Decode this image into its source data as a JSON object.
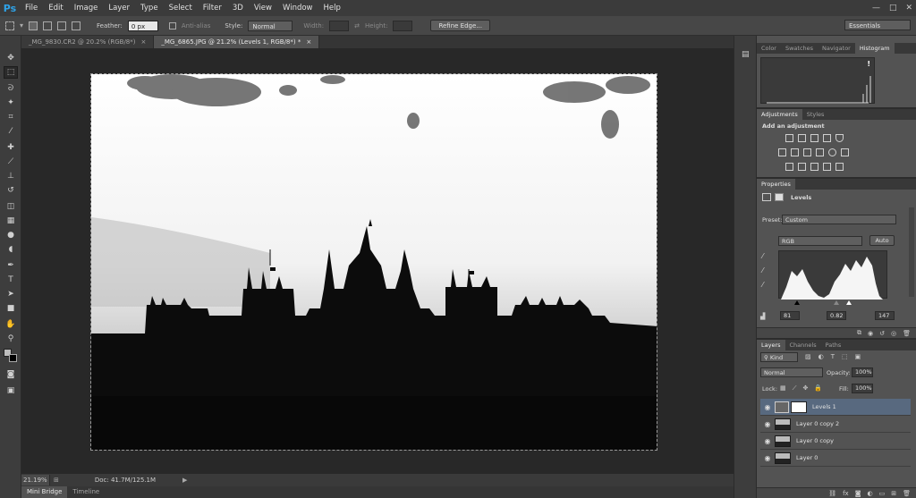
{
  "app": {
    "logo": "Ps"
  },
  "menu": [
    "File",
    "Edit",
    "Image",
    "Layer",
    "Type",
    "Select",
    "Filter",
    "3D",
    "View",
    "Window",
    "Help"
  ],
  "window_controls": [
    "—",
    "□",
    "✕"
  ],
  "options": {
    "feather_label": "Feather:",
    "feather_value": "0 px",
    "antialias_label": "Anti-alias",
    "style_label": "Style:",
    "style_value": "Normal",
    "width_label": "Width:",
    "height_label": "Height:",
    "refine_edge": "Refine Edge...",
    "workspace": "Essentials"
  },
  "doc_tabs": [
    {
      "title": "_MG_9830.CR2 @ 20.2% (RGB/8*)",
      "close": "×"
    },
    {
      "title": "_MG_6865.JPG @ 21.2% (Levels 1, RGB/8*) *",
      "close": "×"
    }
  ],
  "status": {
    "zoom": "21.19%",
    "doc": "Doc: 41.7M/125.1M"
  },
  "bottom_tabs": [
    "Mini Bridge",
    "Timeline"
  ],
  "histogram_panel": {
    "tabs": [
      "Color",
      "Swatches",
      "Navigator",
      "Histogram"
    ],
    "warning": "!"
  },
  "adjustments_panel": {
    "tabs": [
      "Adjustments",
      "Styles"
    ],
    "heading": "Add an adjustment"
  },
  "properties_panel": {
    "tab": "Properties",
    "title": "Levels",
    "preset_label": "Preset:",
    "preset_value": "Custom",
    "channel": "RGB",
    "auto_button": "Auto",
    "input_black": "81",
    "input_gamma": "0.82",
    "input_white": "147"
  },
  "layers_panel": {
    "tabs": [
      "Layers",
      "Channels",
      "Paths"
    ],
    "filter_kind": "Kind",
    "blend_mode": "Normal",
    "opacity_label": "Opacity:",
    "opacity_value": "100%",
    "lock_label": "Lock:",
    "fill_label": "Fill:",
    "fill_value": "100%",
    "layers": [
      {
        "name": "Levels 1",
        "selected": true,
        "adjustment": true
      },
      {
        "name": "Layer 0 copy 2",
        "selected": false
      },
      {
        "name": "Layer 0 copy",
        "selected": false
      },
      {
        "name": "Layer 0",
        "selected": false
      }
    ]
  },
  "colors": {
    "accent": "#2fa3e8",
    "selection": "#58697f",
    "canvas_bg": "#282828"
  }
}
